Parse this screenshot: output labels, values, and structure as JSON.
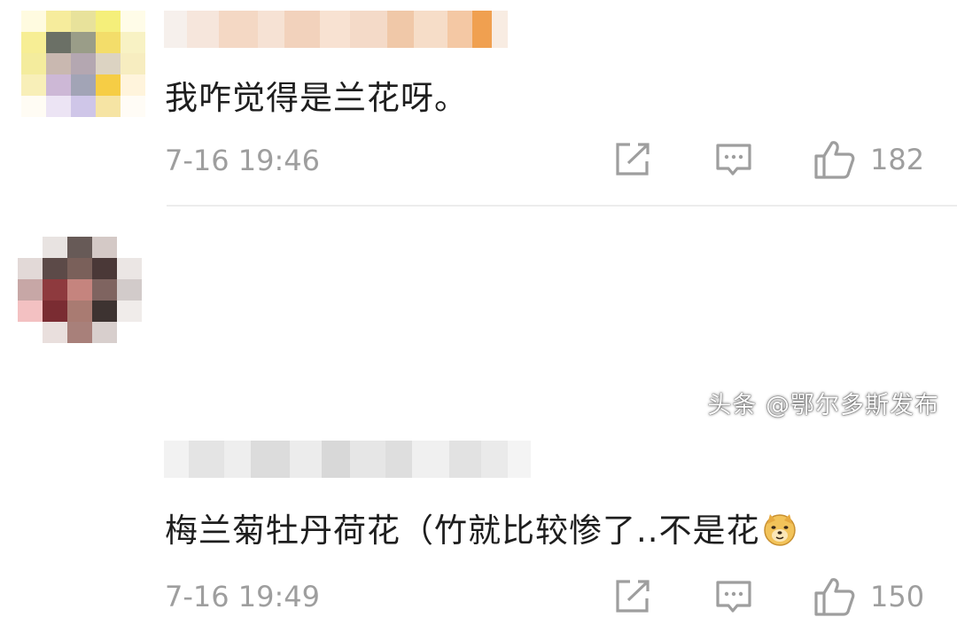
{
  "comments": [
    {
      "text": "我咋觉得是兰花呀。",
      "time": "7-16 19:46",
      "likes": "182",
      "username_blurred": true,
      "avatar_pixels": [
        "#fffbe0",
        "#f6ec9c",
        "#e8e29b",
        "#f5ef7a",
        "#fffce8",
        "#f7ee95",
        "#6b7066",
        "#9a9d88",
        "#f3dd6a",
        "#f8f2c4",
        "#f4ec9d",
        "#c9b8b0",
        "#b4a7b1",
        "#dcd3c2",
        "#f7edc0",
        "#f8efb8",
        "#cdb8d6",
        "#a2a4b6",
        "#f6cd45",
        "#fff4dc",
        "#fffcf4",
        "#ece4f4",
        "#cfc6e8",
        "#f6e4a4",
        "#fffcf6"
      ],
      "username_colors": [
        "#f6f0ec",
        "#f6e6dc",
        "#f4d8c4",
        "#f6e2d4",
        "#f2d2bc",
        "#f8e2d2",
        "#f4dac8",
        "#f0c8a8",
        "#f6ddc8",
        "#f4c8a4",
        "#f0a050",
        "#f8ece2"
      ]
    },
    {
      "text": "梅兰菊牡丹荷花（竹就比较惨了..不是花",
      "time": "7-16 19:49",
      "likes": "150",
      "username_blurred": true,
      "avatar_pixels": [
        "#ffffff",
        "#e8e3e1",
        "#675a57",
        "#d4c9c6",
        "#ffffff",
        "#e2d9d7",
        "#5c4a48",
        "#7a605a",
        "#4a3837",
        "#ebe6e4",
        "#c7a7a6",
        "#8e3a3e",
        "#c5847e",
        "#7f6460",
        "#d2cbca",
        "#f3c1c2",
        "#7a2c32",
        "#a97b72",
        "#3d3331",
        "#f0ecea",
        "#ffffff",
        "#e9dfdd",
        "#a8807a",
        "#d8cfcd",
        "#ffffff"
      ],
      "username_colors": [
        "#f2f2f2",
        "#e4e4e4",
        "#eeeeee",
        "#dcdcdc",
        "#ececec",
        "#d8d8d8",
        "#e6e6e6",
        "#dedede",
        "#f0f0f0",
        "#e2e2e2",
        "#eaeaea",
        "#f4f4f4"
      ]
    }
  ],
  "icons": {
    "share": "share-icon",
    "reply": "comment-icon",
    "like": "thumbs-up-icon",
    "emoji": "doge-emoji-icon"
  },
  "colors": {
    "text": "#1e1e1e",
    "meta": "#9e9e9e",
    "divider": "#ececec"
  },
  "watermark": "头条 @鄂尔多斯发布"
}
